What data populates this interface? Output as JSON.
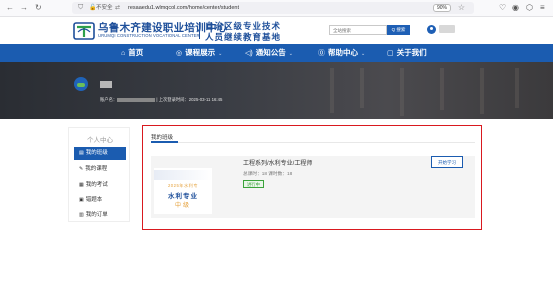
{
  "browser": {
    "url_security": "不安全",
    "url": "resaaedu1.wlmqcol.com/home/center/student",
    "zoom": "90%",
    "icons": [
      "back-arrow-icon",
      "forward-arrow-icon",
      "reload-icon",
      "shield-icon",
      "lock-icon",
      "star-icon",
      "pocket-icon",
      "account-icon",
      "extensions-icon",
      "menu-icon"
    ]
  },
  "header": {
    "org_name_cn": "乌鲁木齐建设职业培训中心",
    "org_name_en": "URUMQI CONSTRUCTION VOCATIONAL CENTER",
    "slogan_line1": "自治区级专业技术",
    "slogan_line2": "人员继续教育基地",
    "search_placeholder": "全站搜索",
    "search_button": "Q 搜索"
  },
  "nav": {
    "items": [
      {
        "icon": "⌂",
        "label": "首页"
      },
      {
        "icon": "◎",
        "label": "课程展示"
      },
      {
        "icon": "◁)",
        "label": "通知公告"
      },
      {
        "icon": "⓪",
        "label": "帮助中心"
      },
      {
        "icon": "▢",
        "label": "关于我们"
      }
    ]
  },
  "banner": {
    "account_label": "账户名：",
    "last_login": "| 上次登录时间：2025-03-11 16:45"
  },
  "sidebar": {
    "title": "个人中心",
    "items": [
      {
        "icon": "▤",
        "label": "我的班级"
      },
      {
        "icon": "✎",
        "label": "我的课程"
      },
      {
        "icon": "▦",
        "label": "我的考试"
      },
      {
        "icon": "▣",
        "label": "错题本"
      },
      {
        "icon": "▥",
        "label": "我的订单"
      }
    ]
  },
  "main": {
    "tab_label": "我的班级",
    "course": {
      "thumb_year": "2025年水利专",
      "thumb_major": "水利专业",
      "thumb_level": "中级",
      "name": "工程系列/水利专业/工程师",
      "meta": "总课时：18    课时数：18",
      "status": "进行中",
      "action": "开始学习"
    }
  },
  "colors": {
    "brand_blue": "#1b5cb0",
    "highlight_red": "#d9191f",
    "status_green": "#3aa33a",
    "accent_orange": "#e5a13b"
  }
}
